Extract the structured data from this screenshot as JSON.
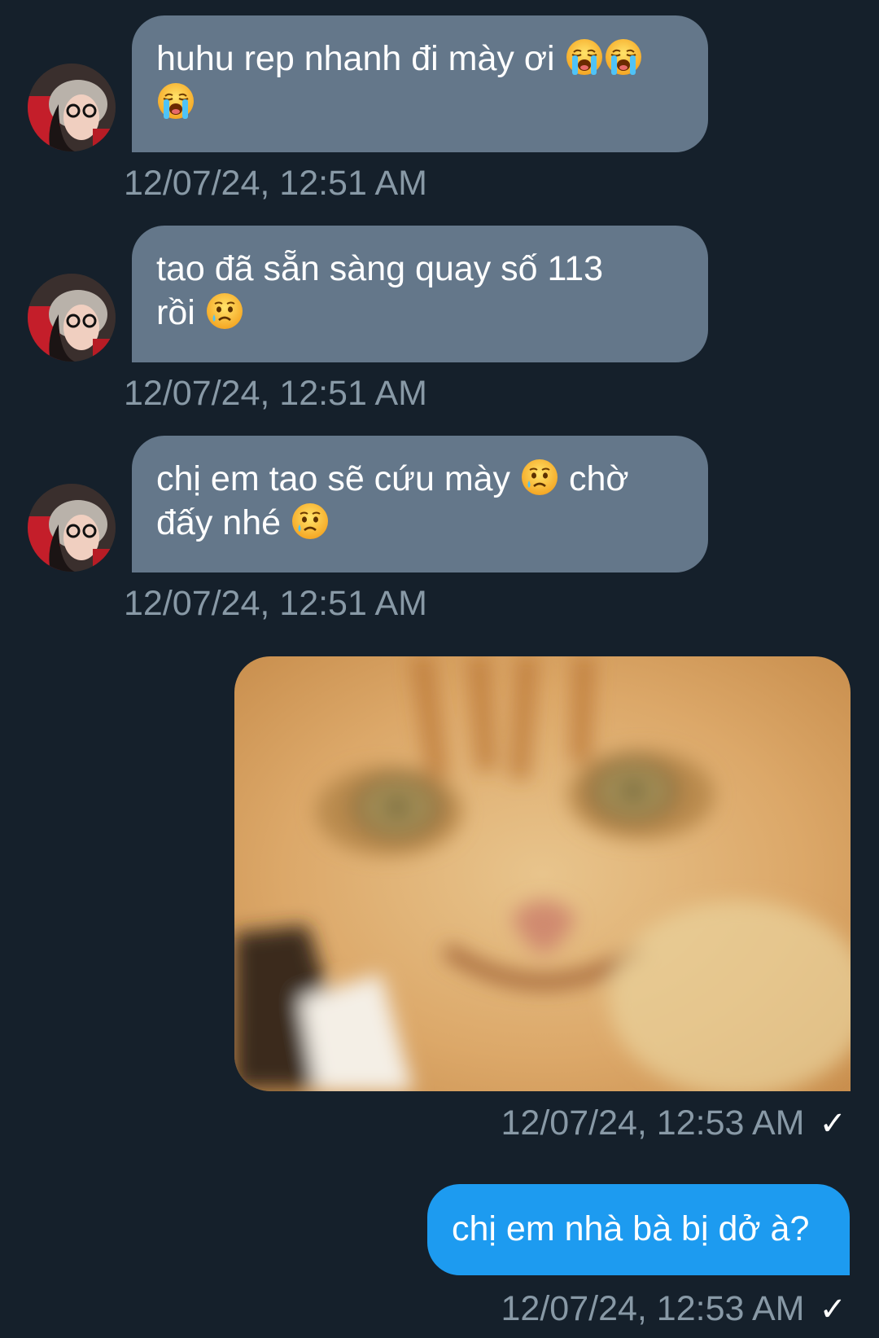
{
  "messages": [
    {
      "direction": "incoming",
      "text_before": "huhu rep nhanh đi mày ơi",
      "emojis": [
        "loudly-crying-face",
        "loudly-crying-face",
        "loudly-crying-face"
      ],
      "timestamp": "12/07/24, 12:51 AM"
    },
    {
      "direction": "incoming",
      "text_before": "tao đã sẵn sàng quay số 113",
      "text_line2": "rồi",
      "emojis": [
        "crying-face"
      ],
      "timestamp": "12/07/24, 12:51 AM"
    },
    {
      "direction": "incoming",
      "text_before": "chị em tao sẽ cứu mày",
      "text_after": "chờ",
      "text_line2": "đấy nhé",
      "emojis": [
        "crying-face",
        "crying-face"
      ],
      "timestamp": "12/07/24, 12:51 AM"
    },
    {
      "direction": "outgoing",
      "type": "image",
      "image_alt": "orange cat close-up photo",
      "timestamp": "12/07/24, 12:53 AM",
      "status": "✓"
    },
    {
      "direction": "outgoing",
      "text_before": "chị em nhà bà bị dở à?",
      "timestamp": "12/07/24, 12:53 AM",
      "status": "✓"
    }
  ],
  "colors": {
    "background": "#15202b",
    "incoming_bubble": "#64778a",
    "outgoing_bubble": "#1d9bf0",
    "timestamp": "#8899a6"
  }
}
